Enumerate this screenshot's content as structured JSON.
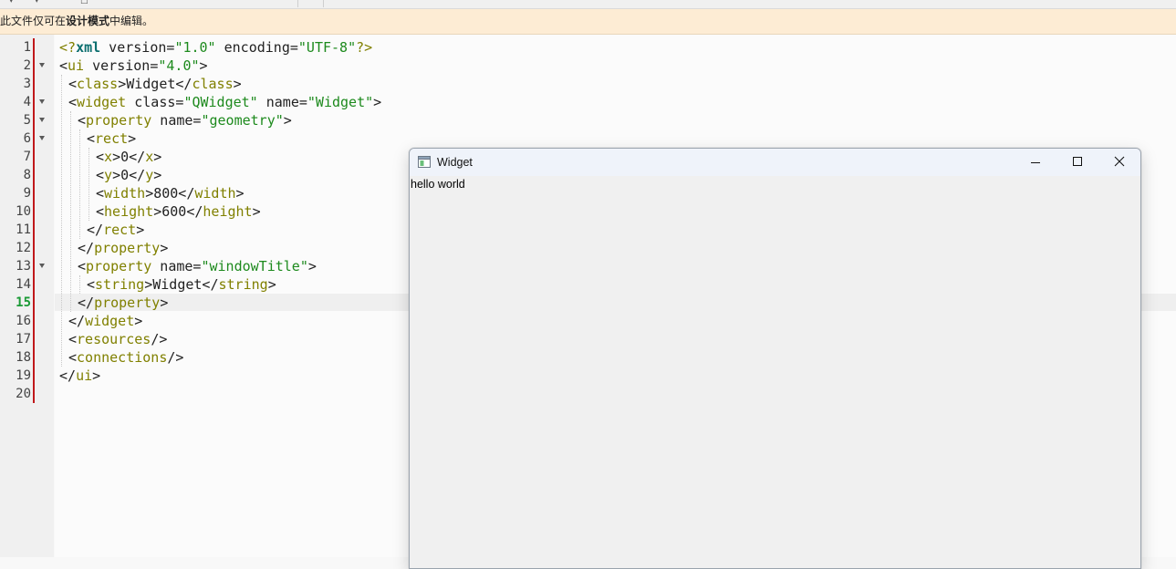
{
  "infobar": {
    "message_prefix": "此文件仅可在",
    "message_bold": "设计模式",
    "message_suffix": "中编辑。"
  },
  "editor": {
    "current_line": 15,
    "lines": [
      {
        "n": "1",
        "fold": false,
        "indent": 0
      },
      {
        "n": "2",
        "fold": true,
        "indent": 0
      },
      {
        "n": "3",
        "fold": false,
        "indent": 1
      },
      {
        "n": "4",
        "fold": true,
        "indent": 1
      },
      {
        "n": "5",
        "fold": true,
        "indent": 2
      },
      {
        "n": "6",
        "fold": true,
        "indent": 3
      },
      {
        "n": "7",
        "fold": false,
        "indent": 4
      },
      {
        "n": "8",
        "fold": false,
        "indent": 4
      },
      {
        "n": "9",
        "fold": false,
        "indent": 4
      },
      {
        "n": "10",
        "fold": false,
        "indent": 4
      },
      {
        "n": "11",
        "fold": false,
        "indent": 3
      },
      {
        "n": "12",
        "fold": false,
        "indent": 2
      },
      {
        "n": "13",
        "fold": true,
        "indent": 2
      },
      {
        "n": "14",
        "fold": false,
        "indent": 3
      },
      {
        "n": "15",
        "fold": false,
        "indent": 2
      },
      {
        "n": "16",
        "fold": false,
        "indent": 1
      },
      {
        "n": "17",
        "fold": false,
        "indent": 1
      },
      {
        "n": "18",
        "fold": false,
        "indent": 1
      },
      {
        "n": "19",
        "fold": false,
        "indent": 0
      },
      {
        "n": "20",
        "fold": false,
        "indent": 0
      }
    ],
    "code": [
      [
        [
          "t",
          "<?"
        ],
        [
          "p",
          "xml"
        ],
        [
          "x",
          " version="
        ],
        [
          "s",
          "\"1.0\""
        ],
        [
          "x",
          " encoding="
        ],
        [
          "s",
          "\"UTF-8\""
        ],
        [
          "t",
          "?>"
        ]
      ],
      [
        [
          "x",
          "<"
        ],
        [
          "t",
          "ui"
        ],
        [
          "x",
          " version="
        ],
        [
          "s",
          "\"4.0\""
        ],
        [
          "x",
          ">"
        ]
      ],
      [
        [
          "x",
          "<"
        ],
        [
          "t",
          "class"
        ],
        [
          "x",
          ">Widget</"
        ],
        [
          "t",
          "class"
        ],
        [
          "x",
          ">"
        ]
      ],
      [
        [
          "x",
          "<"
        ],
        [
          "t",
          "widget"
        ],
        [
          "x",
          " class="
        ],
        [
          "s",
          "\"QWidget\""
        ],
        [
          "x",
          " name="
        ],
        [
          "s",
          "\"Widget\""
        ],
        [
          "x",
          ">"
        ]
      ],
      [
        [
          "x",
          "<"
        ],
        [
          "t",
          "property"
        ],
        [
          "x",
          " name="
        ],
        [
          "s",
          "\"geometry\""
        ],
        [
          "x",
          ">"
        ]
      ],
      [
        [
          "x",
          "<"
        ],
        [
          "t",
          "rect"
        ],
        [
          "x",
          ">"
        ]
      ],
      [
        [
          "x",
          "<"
        ],
        [
          "t",
          "x"
        ],
        [
          "x",
          ">0</"
        ],
        [
          "t",
          "x"
        ],
        [
          "x",
          ">"
        ]
      ],
      [
        [
          "x",
          "<"
        ],
        [
          "t",
          "y"
        ],
        [
          "x",
          ">0</"
        ],
        [
          "t",
          "y"
        ],
        [
          "x",
          ">"
        ]
      ],
      [
        [
          "x",
          "<"
        ],
        [
          "t",
          "width"
        ],
        [
          "x",
          ">800</"
        ],
        [
          "t",
          "width"
        ],
        [
          "x",
          ">"
        ]
      ],
      [
        [
          "x",
          "<"
        ],
        [
          "t",
          "height"
        ],
        [
          "x",
          ">600</"
        ],
        [
          "t",
          "height"
        ],
        [
          "x",
          ">"
        ]
      ],
      [
        [
          "x",
          "</"
        ],
        [
          "t",
          "rect"
        ],
        [
          "x",
          ">"
        ]
      ],
      [
        [
          "x",
          "</"
        ],
        [
          "t",
          "property"
        ],
        [
          "x",
          ">"
        ]
      ],
      [
        [
          "x",
          "<"
        ],
        [
          "t",
          "property"
        ],
        [
          "x",
          " name="
        ],
        [
          "s",
          "\"windowTitle\""
        ],
        [
          "x",
          ">"
        ]
      ],
      [
        [
          "x",
          "<"
        ],
        [
          "t",
          "string"
        ],
        [
          "x",
          ">Widget</"
        ],
        [
          "t",
          "string"
        ],
        [
          "x",
          ">"
        ]
      ],
      [
        [
          "x",
          "</"
        ],
        [
          "t",
          "property"
        ],
        [
          "x",
          ">"
        ]
      ],
      [
        [
          "x",
          "</"
        ],
        [
          "t",
          "widget"
        ],
        [
          "x",
          ">"
        ]
      ],
      [
        [
          "x",
          "<"
        ],
        [
          "t",
          "resources"
        ],
        [
          "x",
          "/>"
        ]
      ],
      [
        [
          "x",
          "<"
        ],
        [
          "t",
          "connections"
        ],
        [
          "x",
          "/>"
        ]
      ],
      [
        [
          "x",
          "</"
        ],
        [
          "t",
          "ui"
        ],
        [
          "x",
          ">"
        ]
      ],
      []
    ]
  },
  "qt_window": {
    "title": "Widget",
    "label": "hello world",
    "controls": [
      "minimize-icon",
      "maximize-icon",
      "close-icon"
    ]
  },
  "colors": {
    "tag": "#808000",
    "string": "#1d8a1d",
    "pi": "#0b6e6e",
    "current_line_number": "#1a9a35",
    "change_bar": "#c0181b",
    "infobar_bg": "#fdecd4"
  }
}
